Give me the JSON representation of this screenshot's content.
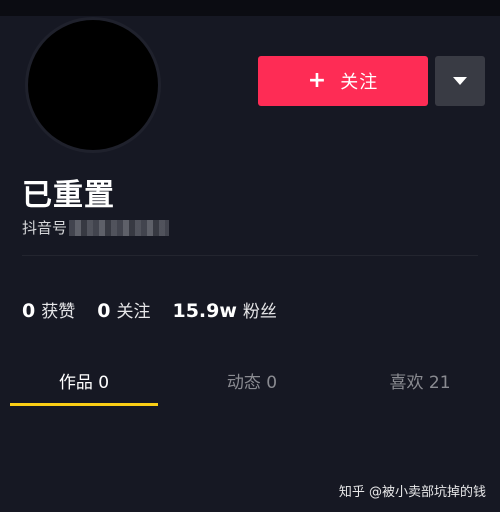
{
  "header": {
    "follow_plus": "+",
    "follow_label": "关注",
    "more_icon": "caret-down-icon"
  },
  "profile": {
    "nickname": "已重置",
    "id_label": "抖音号"
  },
  "stats": [
    {
      "value": "0",
      "label": "获赞"
    },
    {
      "value": "0",
      "label": "关注"
    },
    {
      "value": "15.9w",
      "label": "粉丝"
    }
  ],
  "tabs": [
    {
      "label": "作品 0",
      "active": true
    },
    {
      "label": "动态 0",
      "active": false
    },
    {
      "label": "喜欢 21",
      "active": false
    }
  ],
  "watermark": "知乎 @被小卖部坑掉的钱",
  "colors": {
    "background": "#161823",
    "follow_button": "#fe2c55",
    "more_button": "#393b44",
    "tab_indicator": "#face15"
  }
}
